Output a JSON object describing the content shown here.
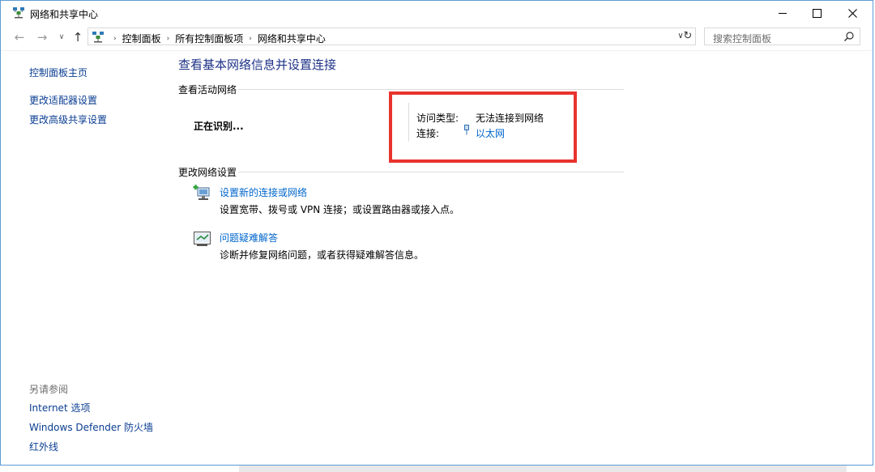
{
  "window": {
    "title": "网络和共享中心"
  },
  "nav": {
    "breadcrumbs": [
      "控制面板",
      "所有控制面板项",
      "网络和共享中心"
    ],
    "search_placeholder": "搜索控制面板"
  },
  "sidebar": {
    "links": [
      "控制面板主页",
      "更改适配器设置",
      "更改高级共享设置"
    ],
    "see_also_heading": "另请参阅",
    "see_also": [
      "Internet 选项",
      "Windows Defender 防火墙",
      "红外线"
    ]
  },
  "main": {
    "title": "查看基本网络信息并设置连接",
    "active_heading": "查看活动网络",
    "network_name": "正在识别...",
    "access_label": "访问类型:",
    "access_value": "无法连接到网络",
    "connection_label": "连接:",
    "connection_value": "以太网",
    "change_heading": "更改网络设置",
    "tasks": [
      {
        "link": "设置新的连接或网络",
        "desc": "设置宽带、拨号或 VPN 连接；或设置路由器或接入点。"
      },
      {
        "link": "问题疑难解答",
        "desc": "诊断并修复网络问题，或者获得疑难解答信息。"
      }
    ]
  },
  "colors": {
    "highlight_border": "#e8332c",
    "link": "#0066cc",
    "title": "#1e3287"
  }
}
